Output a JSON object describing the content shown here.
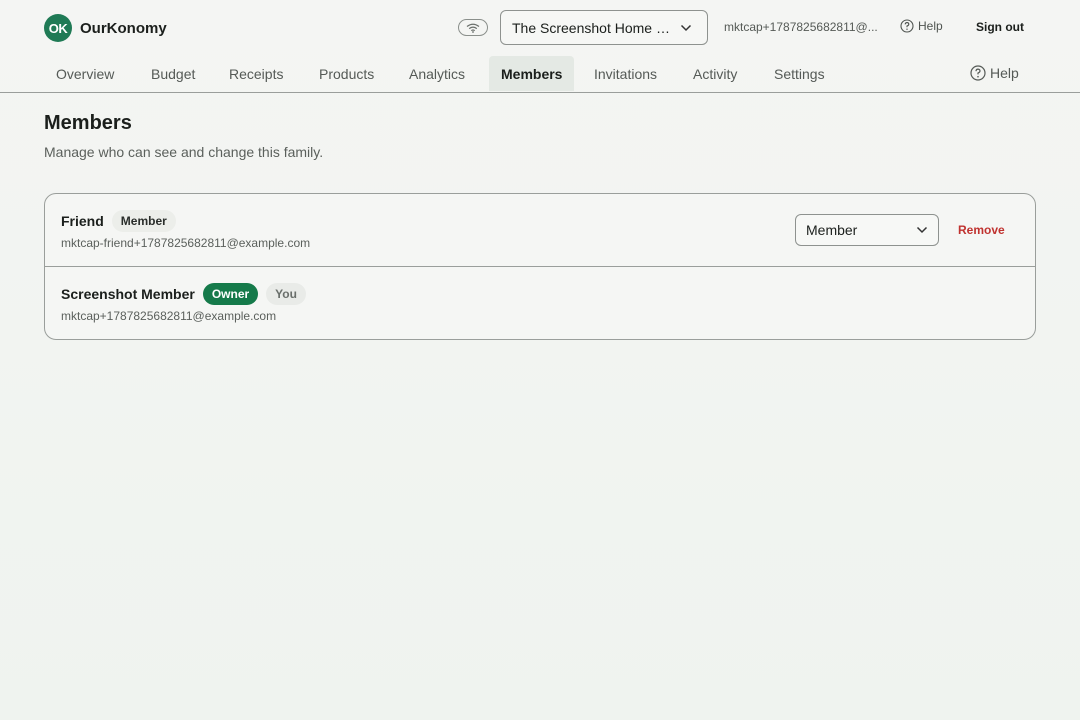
{
  "brand": {
    "logo_text": "OK",
    "name": "OurKonomy",
    "logo_color": "#1f7a55"
  },
  "header": {
    "family_select_value": "The Screenshot Home · ...",
    "user_email": "mktcap+1787825682811@...",
    "help_label": "Help",
    "signout_label": "Sign out"
  },
  "nav": {
    "tabs": [
      {
        "label": "Overview"
      },
      {
        "label": "Budget"
      },
      {
        "label": "Receipts"
      },
      {
        "label": "Products"
      },
      {
        "label": "Analytics"
      },
      {
        "label": "Members",
        "active": true
      },
      {
        "label": "Invitations"
      },
      {
        "label": "Activity"
      },
      {
        "label": "Settings"
      }
    ],
    "help_label": "Help"
  },
  "page": {
    "title": "Members",
    "subtitle": "Manage who can see and change this family."
  },
  "members": [
    {
      "name": "Friend",
      "role_badge": "Member",
      "email": "mktcap-friend+1787825682811@example.com",
      "role_select_value": "Member",
      "remove_label": "Remove"
    },
    {
      "name": "Screenshot Member",
      "role_badge": "Owner",
      "you_badge": "You",
      "email": "mktcap+1787825682811@example.com"
    }
  ],
  "colors": {
    "accent": "#157a4a",
    "danger": "#c0322f"
  }
}
